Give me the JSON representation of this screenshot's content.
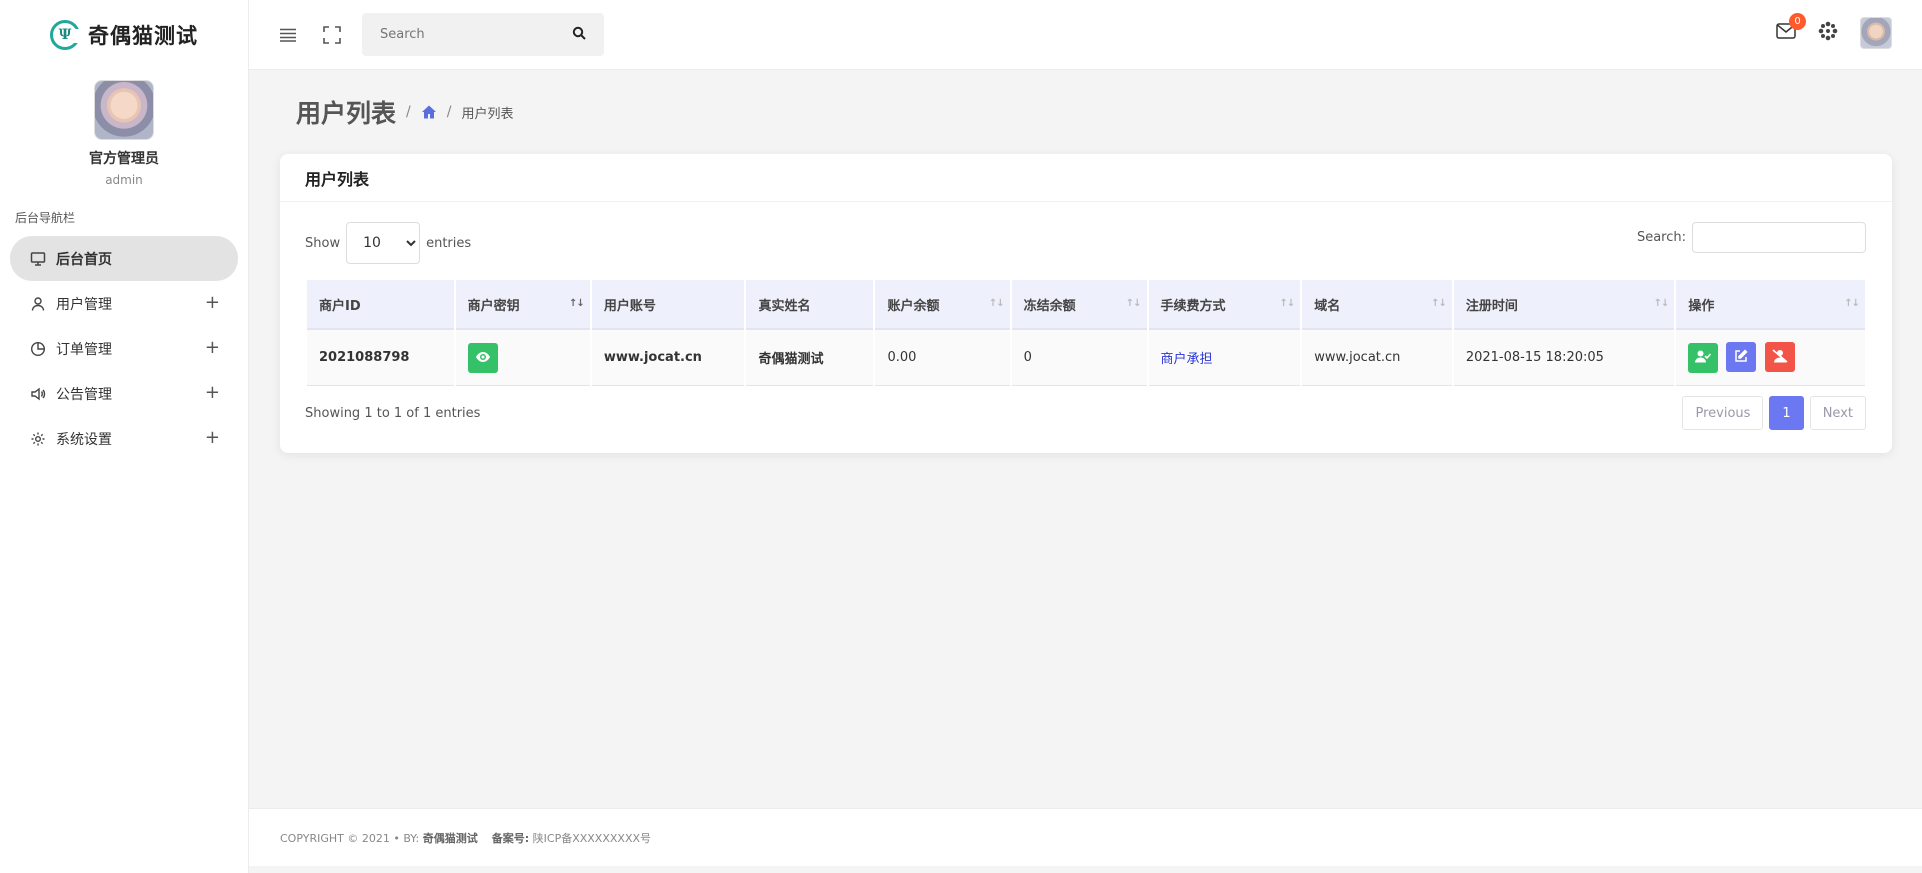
{
  "brand": {
    "title": "奇偶猫测试"
  },
  "profile": {
    "name": "官方管理员",
    "role": "admin"
  },
  "sidebar": {
    "heading": "后台导航栏",
    "items": [
      {
        "label": "后台首页",
        "icon": "monitor-icon",
        "active": true
      },
      {
        "label": "用户管理",
        "icon": "user-icon"
      },
      {
        "label": "订单管理",
        "icon": "pie-chart-icon"
      },
      {
        "label": "公告管理",
        "icon": "speaker-icon"
      },
      {
        "label": "系统设置",
        "icon": "gear-icon"
      }
    ]
  },
  "header": {
    "search_placeholder": "Search",
    "mail_count": "0"
  },
  "page": {
    "title": "用户列表",
    "breadcrumb_current": "用户列表"
  },
  "card": {
    "title": "用户列表",
    "show_label": "Show",
    "entries_label": "entries",
    "page_size": "10",
    "search_label": "Search:",
    "columns": [
      "商户ID",
      "商户密钥",
      "用户账号",
      "真实姓名",
      "账户余额",
      "冻结余额",
      "手续费方式",
      "域名",
      "注册时间",
      "操作"
    ],
    "rows": [
      {
        "merchant_id": "2021088798",
        "account": "www.jocat.cn",
        "real_name": "奇偶猫测试",
        "balance": "0.00",
        "frozen": "0",
        "fee_mode": "商户承担",
        "domain": "www.jocat.cn",
        "registered": "2021-08-15 18:20:05"
      }
    ],
    "info": "Showing 1 to 1 of 1 entries",
    "pager": {
      "prev": "Previous",
      "current": "1",
      "next": "Next"
    }
  },
  "footer": {
    "copyright": "COPYRIGHT © 2021  • BY:",
    "by": "奇偶猫测试",
    "icp_label": "备案号:",
    "icp": "陕ICP备XXXXXXXXX号"
  }
}
